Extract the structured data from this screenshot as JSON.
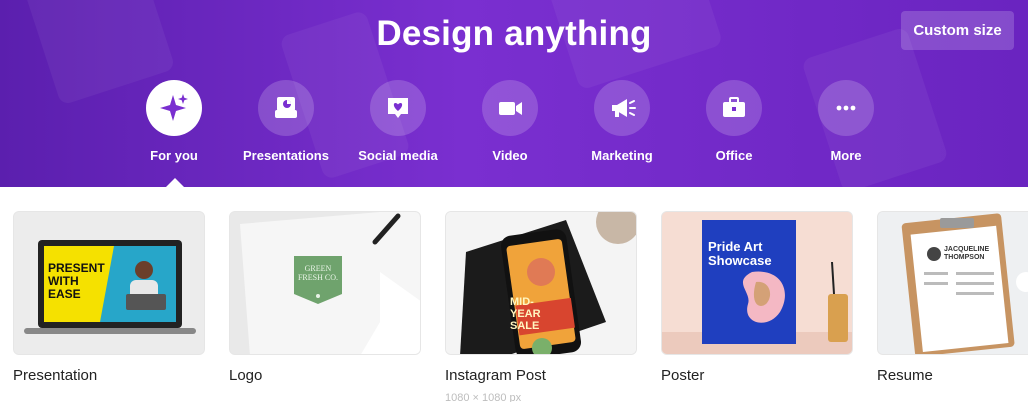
{
  "header": {
    "title": "Design anything",
    "custom_size_label": "Custom size"
  },
  "categories": [
    {
      "label": "For you",
      "icon": "sparkles-icon",
      "active": true
    },
    {
      "label": "Presentations",
      "icon": "presentation-chart-icon",
      "active": false
    },
    {
      "label": "Social media",
      "icon": "heart-chat-icon",
      "active": false
    },
    {
      "label": "Video",
      "icon": "video-camera-icon",
      "active": false
    },
    {
      "label": "Marketing",
      "icon": "megaphone-icon",
      "active": false
    },
    {
      "label": "Office",
      "icon": "briefcase-icon",
      "active": false
    },
    {
      "label": "More",
      "icon": "more-dots-icon",
      "active": false
    }
  ],
  "designs": [
    {
      "name": "Presentation",
      "thumb_text": "PRESENT WITH EASE",
      "size": ""
    },
    {
      "name": "Logo",
      "thumb_text": "GREEN FRESH CO.",
      "size": ""
    },
    {
      "name": "Instagram Post",
      "thumb_text": "MID-YEAR SALE",
      "size": "1080 × 1080 px"
    },
    {
      "name": "Poster",
      "thumb_text": "Pride Art Showcase",
      "size": ""
    },
    {
      "name": "Resume",
      "thumb_text": "JACQUELINE THOMPSON",
      "size": ""
    }
  ],
  "colors": {
    "brand_purple": "#7a2fd0",
    "accent_blue": "#1f3fbf"
  }
}
